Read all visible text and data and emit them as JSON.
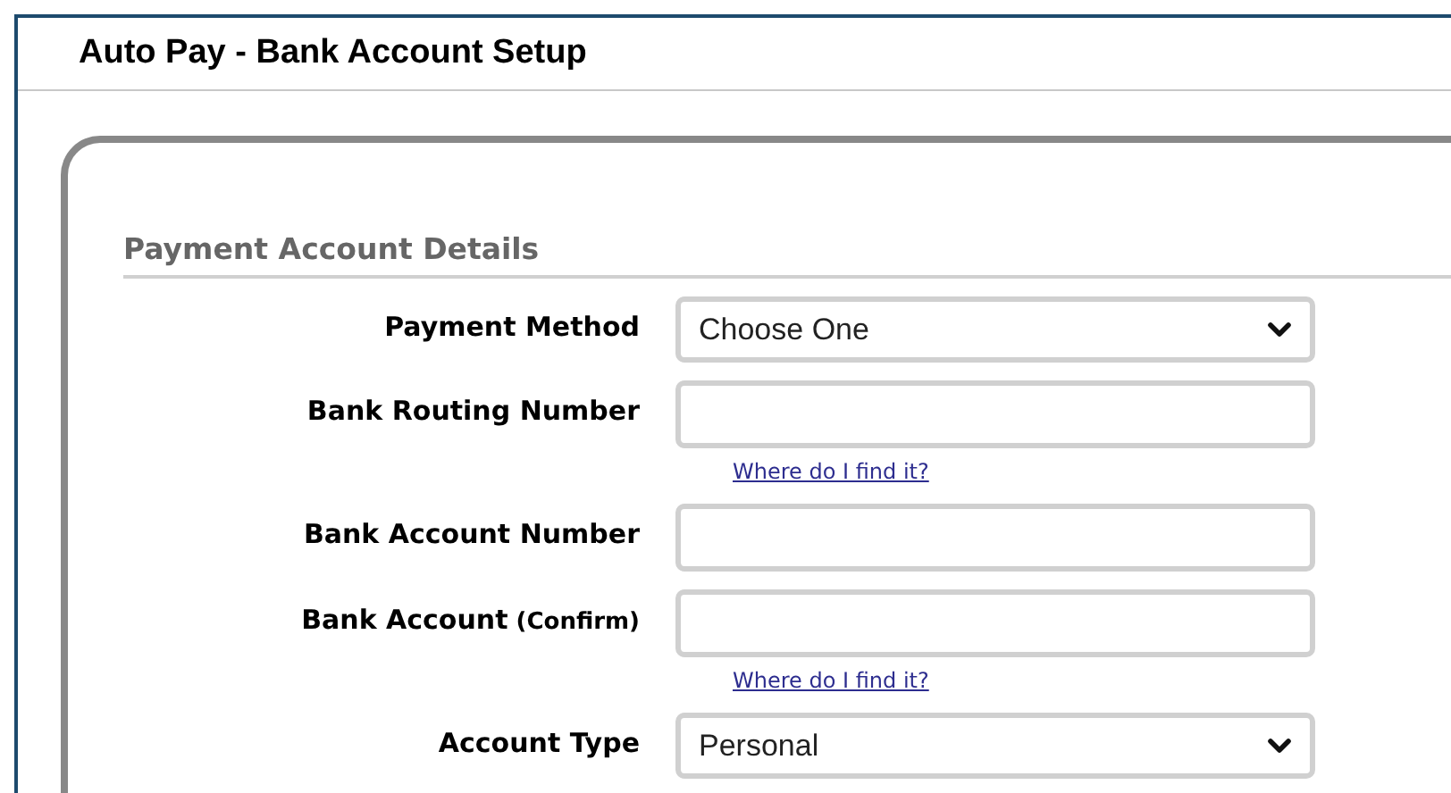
{
  "window": {
    "title": "Auto Pay - Bank Account Setup"
  },
  "section": {
    "title": "Payment Account Details"
  },
  "fields": [
    {
      "kind": "select",
      "label": "Payment Method",
      "value": "Choose One"
    },
    {
      "kind": "input",
      "label": "Bank Routing Number",
      "help_link": "Where do I find it?"
    },
    {
      "kind": "input",
      "label": "Bank Account Number"
    },
    {
      "kind": "input",
      "label": "Bank Account",
      "label_note": "(Confirm)",
      "help_link": "Where do I find it?"
    },
    {
      "kind": "select",
      "label": "Account Type",
      "value": "Personal"
    }
  ]
}
